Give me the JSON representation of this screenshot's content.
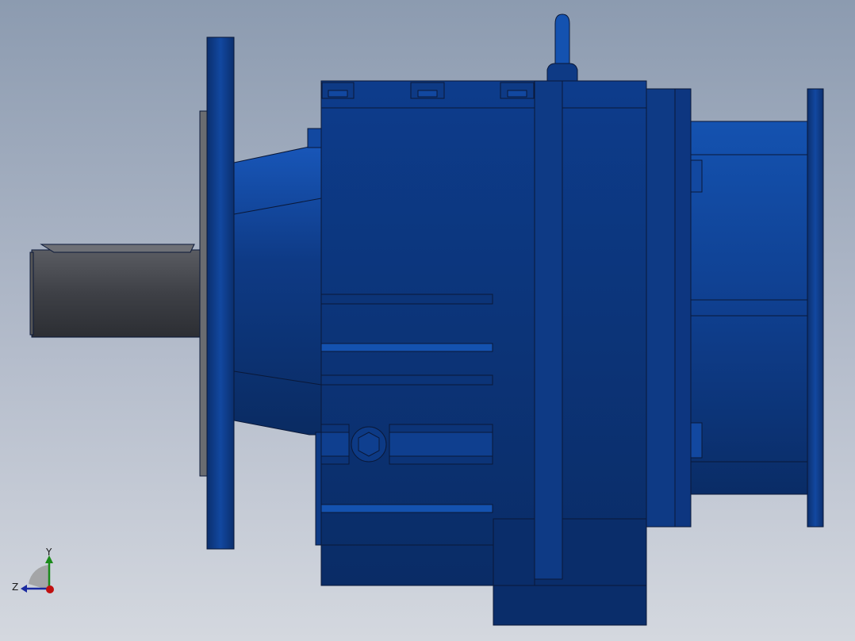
{
  "viewport": {
    "model": "gear-reducer",
    "colors": {
      "background_top": "#8c9bb0",
      "background_bottom": "#d4d8df",
      "housing": "#0f3f8f",
      "housing_dark": "#0b2f6e",
      "housing_light": "#1a56b8",
      "shaft": "#4a4c52",
      "edge": "#0a1838"
    }
  },
  "triad": {
    "y_label": "Y",
    "z_label": "Z",
    "y_color": "#1a8a1a",
    "z_color": "#1a2aa0",
    "origin_color": "#c01010"
  }
}
